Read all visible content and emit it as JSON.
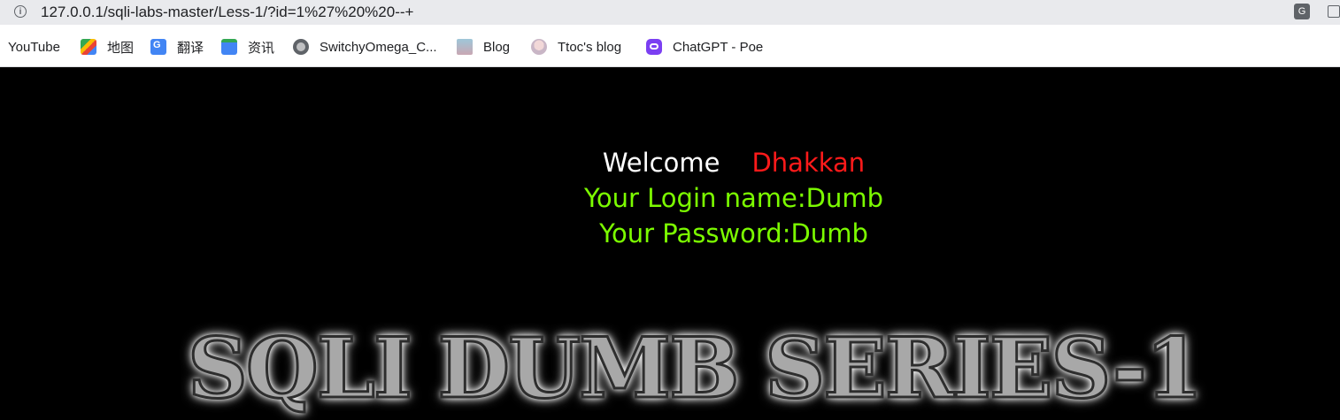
{
  "browser": {
    "url": "127.0.0.1/sqli-labs-master/Less-1/?id=1%27%20%20--+"
  },
  "bookmarks": [
    {
      "label": "YouTube",
      "icon": "none"
    },
    {
      "label": "地图",
      "icon": "maps-icon"
    },
    {
      "label": "翻译",
      "icon": "translate-icon"
    },
    {
      "label": "资讯",
      "icon": "news-icon"
    },
    {
      "label": "SwitchyOmega_C...",
      "icon": "globe-icon"
    },
    {
      "label": "Blog",
      "icon": "blog-icon"
    },
    {
      "label": "Ttoc's blog",
      "icon": "avatar-icon"
    },
    {
      "label": "ChatGPT - Poe",
      "icon": "poe-icon"
    }
  ],
  "content": {
    "welcome": "Welcome",
    "user": "Dhakkan",
    "login_line": "Your Login name:Dumb",
    "password_line": "Your Password:Dumb",
    "banner": "SQLI DUMB SERIES-1"
  },
  "colors": {
    "background": "#000000",
    "welcome": "#ffffff",
    "name": "#ff1a1a",
    "result": "#7cfc00"
  }
}
